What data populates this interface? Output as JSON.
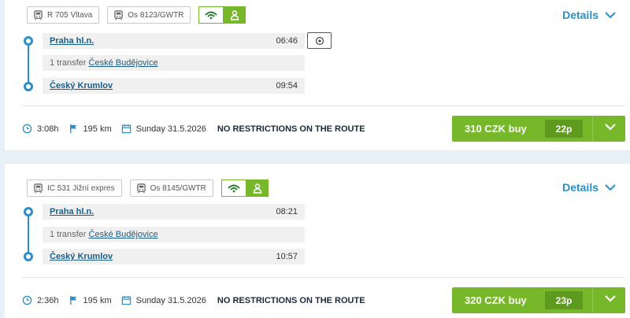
{
  "connections": [
    {
      "trains": [
        "R 705 Vltava",
        "Os 8123/GWTR"
      ],
      "details_label": "Details",
      "from_station": "Praha hl.n.",
      "departure": "06:46",
      "transfer_prefix": "1 transfer",
      "transfer_station": "České Budějovice",
      "to_station": "Český Krumlov",
      "arrival": "09:54",
      "duration": "3:08h",
      "distance": "195 km",
      "date": "Sunday 31.5.2026",
      "restriction": "NO RESTRICTIONS ON THE ROUTE",
      "price_label": "310 CZK buy",
      "seats": "22p"
    },
    {
      "trains": [
        "IC 531 Jižní expres",
        "Os 8145/GWTR"
      ],
      "details_label": "Details",
      "from_station": "Praha hl.n.",
      "departure": "08:21",
      "transfer_prefix": "1 transfer",
      "transfer_station": "České Budějovice",
      "to_station": "Český Krumlov",
      "arrival": "10:57",
      "duration": "2:36h",
      "distance": "195 km",
      "date": "Sunday 31.5.2026",
      "restriction": "NO RESTRICTIONS ON THE ROUTE",
      "price_label": "320 CZK buy",
      "seats": "23p"
    }
  ],
  "icons": {
    "train": "train-icon",
    "wifi": "wifi-icon",
    "person": "person-icon",
    "map": "map-icon",
    "clock": "clock-icon",
    "flag": "flag-icon",
    "calendar": "calendar-icon",
    "chevron": "chevron-down-icon"
  },
  "colors": {
    "accent_blue": "#2b8fc9",
    "buy_green": "#76b82a",
    "seats_green": "#5d9a1e",
    "background": "#e8f0f7"
  }
}
